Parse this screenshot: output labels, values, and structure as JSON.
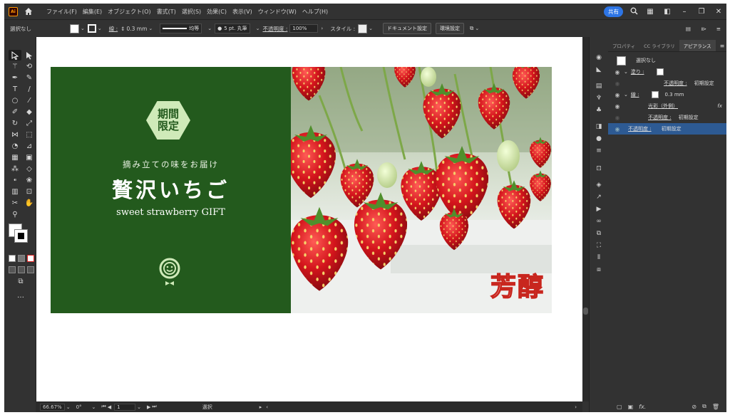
{
  "app": {
    "logo": "Ai",
    "home_icon": "home-icon"
  },
  "menu": [
    "ファイル(F)",
    "編集(E)",
    "オブジェクト(O)",
    "書式(T)",
    "選択(S)",
    "効果(C)",
    "表示(V)",
    "ウィンドウ(W)",
    "ヘルプ(H)"
  ],
  "menubar_right": {
    "share": "共有",
    "search_icon": "search-icon"
  },
  "controlbar": {
    "selection": "選択なし",
    "stroke_label": "線 :",
    "stroke_weight": "0.3 mm",
    "profile": "均等",
    "brush": "5 pt. 丸筆",
    "opacity_label": "不透明度 :",
    "opacity_value": "100%",
    "style_label": "スタイル :",
    "doc_setup": "ドキュメント設定",
    "prefs": "環境設定"
  },
  "statusbar": {
    "zoom": "66.67%",
    "rotation": "0°",
    "artboard": "1",
    "mode": "選択"
  },
  "banner": {
    "badge_line1": "期間",
    "badge_line2": "限定",
    "tagline": "摘み立ての味をお届け",
    "title": "贅沢いちご",
    "subtitle": "sweet strawberry GIFT",
    "brand": "芳醇",
    "colors": {
      "green": "#235a1d",
      "badge": "#cfeab9",
      "brand_outline": "#c8261e"
    }
  },
  "panel": {
    "tabs": [
      "プロパティ",
      "CC ライブラリ",
      "アピアランス"
    ],
    "active_tab": "アピアランス",
    "header": "選択なし",
    "fill_label": "塗り :",
    "opacity_label": "不透明度 :",
    "opacity_default": "初期設定",
    "stroke_label": "線 :",
    "stroke_value": "0.3 mm",
    "effect_label": "光彩（外側）",
    "fx": "fx",
    "selected_row": 6
  }
}
